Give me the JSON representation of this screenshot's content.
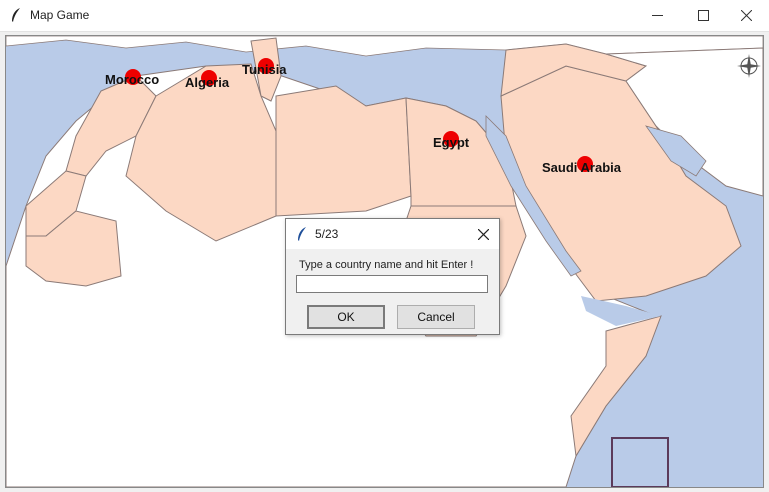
{
  "window": {
    "title": "Map Game",
    "icons": {
      "app": "feather-icon",
      "minimize": "minimize-icon",
      "maximize": "maximize-icon",
      "close": "close-icon"
    }
  },
  "map": {
    "countries": [
      {
        "name": "Morocco"
      },
      {
        "name": "Algeria"
      },
      {
        "name": "Tunisia"
      },
      {
        "name": "Egypt"
      },
      {
        "name": "Saudi Arabia"
      }
    ],
    "colors": {
      "sea": "#b9cbe8",
      "highlight": "#fcd8c4",
      "land": "#ffffff",
      "border": "#8b7a77",
      "marker": "#ee0000"
    }
  },
  "dialog": {
    "title": "5/23",
    "prompt": "Type a country name and hit Enter !",
    "entry_value": "",
    "ok_label": "OK",
    "cancel_label": "Cancel"
  }
}
